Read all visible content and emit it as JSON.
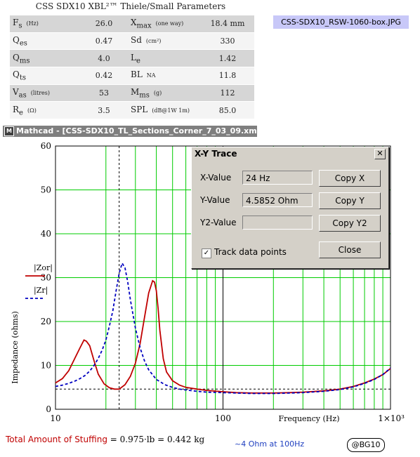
{
  "ts_title": "CSS SDX10 XBL²™ Thiele/Small Parameters",
  "filename_label": "CSS-SDX10_RSW-1060-box.JPG",
  "ts_rows": [
    {
      "sym": "F",
      "sub": "s",
      "unit": "(Hz)",
      "val": "26.0",
      "sym2": "X",
      "sub2": "max",
      "unit2": "(one way)",
      "val2": "18.4 mm"
    },
    {
      "sym": "Q",
      "sub": "es",
      "unit": "",
      "val": "0.47",
      "sym2": "Sd",
      "sub2": "",
      "unit2": "(cm²)",
      "val2": "330"
    },
    {
      "sym": "Q",
      "sub": "ms",
      "unit": "",
      "val": "4.0",
      "sym2": "L",
      "sub2": "e",
      "unit2": "",
      "val2": "1.42"
    },
    {
      "sym": "Q",
      "sub": "ts",
      "unit": "",
      "val": "0.42",
      "sym2": "BL",
      "sub2": "",
      "unit2": "NA",
      "val2": "11.8"
    },
    {
      "sym": "V",
      "sub": "as",
      "unit": "(litres)",
      "val": "53",
      "sym2": "M",
      "sub2": "ms",
      "unit2": "(g)",
      "val2": "112"
    },
    {
      "sym": "R",
      "sub": "e",
      "unit": "(Ω)",
      "val": "3.5",
      "sym2": "SPL",
      "sub2": "",
      "unit2": "(dB@1W 1m)",
      "val2": "85.0"
    }
  ],
  "mathcad_title": "Mathcad - [CSS-SDX10_TL_Sections_Corner_7_03_09.xmcd]",
  "xy_trace": {
    "title": "X-Y Trace",
    "x_label": "X-Value",
    "x_value": "24 Hz",
    "y_label": "Y-Value",
    "y_value": "4.5852 Ohm",
    "y2_label": "Y2-Value",
    "y2_value": "",
    "copy_x": "Copy X",
    "copy_y": "Copy Y",
    "copy_y2": "Copy Y2",
    "close": "Close",
    "track_label": "Track data points",
    "track_checked": true
  },
  "chart_data": {
    "type": "line",
    "xscale": "log",
    "xlim": [
      10,
      1000
    ],
    "ylim": [
      0,
      60
    ],
    "ylabel": "Impedance (ohms)",
    "xlabel": "Frequency (Hz)",
    "yticks": [
      "0",
      "10",
      "20",
      "30",
      "40",
      "50",
      "60"
    ],
    "xticks": [
      "10",
      "100",
      "1×10³"
    ],
    "legend": [
      "|Zor|",
      "|Zr|"
    ],
    "trace_x": 24,
    "ref_y": 4.6,
    "series": [
      {
        "name": "|Zor|",
        "color": "#c00000",
        "style": "solid",
        "x": [
          10,
          11,
          12,
          13,
          14,
          14.8,
          15.3,
          16,
          17,
          18,
          19.5,
          21,
          22.5,
          24,
          26,
          28,
          30,
          32,
          34,
          36,
          38,
          39,
          40,
          41,
          42,
          44,
          46,
          50,
          55,
          60,
          70,
          80,
          100,
          120,
          150,
          180,
          200,
          250,
          300,
          400,
          500,
          600,
          700,
          800,
          900,
          1000
        ],
        "y": [
          6,
          7,
          8.8,
          11.5,
          14,
          15.8,
          15.5,
          14.5,
          11,
          8,
          5.8,
          4.9,
          4.6,
          4.6,
          5.6,
          7.5,
          10.5,
          15,
          21,
          26.5,
          29.3,
          29,
          27,
          23,
          18,
          11.5,
          8.5,
          6.5,
          5.5,
          5,
          4.6,
          4.3,
          4,
          3.8,
          3.7,
          3.7,
          3.7,
          3.8,
          3.9,
          4.2,
          4.6,
          5.2,
          6,
          6.9,
          7.9,
          9.3
        ]
      },
      {
        "name": "|Zr|",
        "color": "#0000c0",
        "style": "dash",
        "x": [
          10,
          11,
          12,
          13,
          14,
          15,
          16,
          17,
          18,
          19,
          20,
          21,
          22,
          23,
          24,
          25,
          26,
          27,
          28,
          30,
          32,
          34,
          36,
          40,
          45,
          50,
          55,
          60,
          70,
          80,
          100,
          120,
          150,
          180,
          200,
          250,
          300,
          400,
          500,
          600,
          700,
          800,
          900,
          1000
        ],
        "y": [
          5.2,
          5.5,
          5.9,
          6.4,
          7,
          7.7,
          8.7,
          10,
          11.6,
          13.5,
          15.8,
          19,
          22.5,
          27,
          31,
          33.3,
          32.2,
          29,
          25,
          18.5,
          14,
          11,
          9,
          6.8,
          5.6,
          5,
          4.6,
          4.4,
          4.1,
          3.9,
          3.8,
          3.7,
          3.6,
          3.6,
          3.6,
          3.7,
          3.8,
          4.1,
          4.5,
          5.1,
          5.9,
          6.8,
          7.9,
          9.4
        ]
      }
    ]
  },
  "formula_label": "Total Amount of Stuffing",
  "formula_math": "= 0.975·lb = 0.442 kg",
  "ohm_note": "~4 Ohm at 100Hz",
  "badge": "@BG10"
}
